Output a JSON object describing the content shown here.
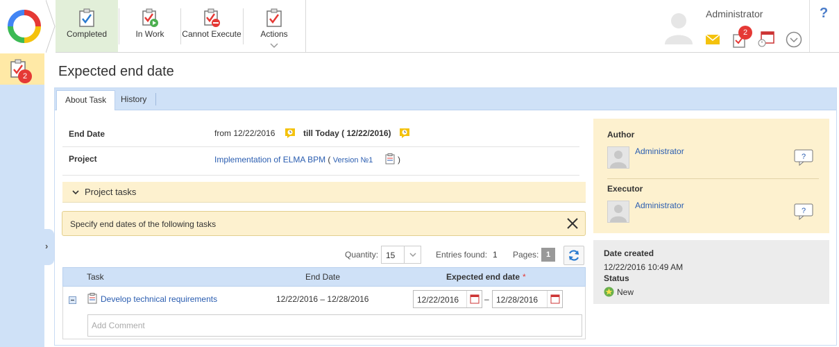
{
  "toolbar": {
    "completed": "Completed",
    "in_work": "In Work",
    "cannot_execute": "Cannot Execute",
    "actions": "Actions"
  },
  "user": {
    "name": "Administrator",
    "tasks_badge": "2"
  },
  "help": "?",
  "sidebar": {
    "tasks_badge": "2"
  },
  "page": {
    "title": "Expected end date"
  },
  "tabs": [
    "About Task",
    "History"
  ],
  "details": {
    "end_date_label": "End Date",
    "end_date_from": "from 12/22/2016",
    "end_date_till": "till Today ( 12/22/2016)",
    "project_label": "Project",
    "project_link": "Implementation of ELMA BPM",
    "project_open_paren": "(",
    "project_version": "Version №1",
    "project_close_paren": ")"
  },
  "project_tasks": {
    "title": "Project tasks"
  },
  "notice": {
    "text": "Specify end dates of the following tasks"
  },
  "pager": {
    "quantity_label": "Quantity:",
    "quantity_value": "15",
    "entries_label": "Entries found:",
    "entries_value": "1",
    "pages_label": "Pages:",
    "page_number": "1"
  },
  "grid": {
    "columns": {
      "task": "Task",
      "end_date": "End Date",
      "expected": "Expected end date",
      "required": "*"
    },
    "rows": [
      {
        "task": "Develop technical requirements",
        "end_date": "12/22/2016 – 12/28/2016",
        "expected_from": "12/22/2016",
        "range_sep": "–",
        "expected_to": "12/28/2016",
        "comment_placeholder": "Add Comment"
      }
    ]
  },
  "people": {
    "author_label": "Author",
    "author_name": "Administrator",
    "executor_label": "Executor",
    "executor_name": "Administrator",
    "bubble_text": "?"
  },
  "meta": {
    "date_created_label": "Date created",
    "date_created_value": "12/22/2016 10:49 AM",
    "status_label": "Status",
    "status_value": "New"
  },
  "colors": {
    "accent_blue": "#2a5db0",
    "active_tab_green": "#e2efd9",
    "badge_red": "#e53935",
    "notice_yellow": "#fdf1cf",
    "panel_blue": "#cfe1f7"
  }
}
